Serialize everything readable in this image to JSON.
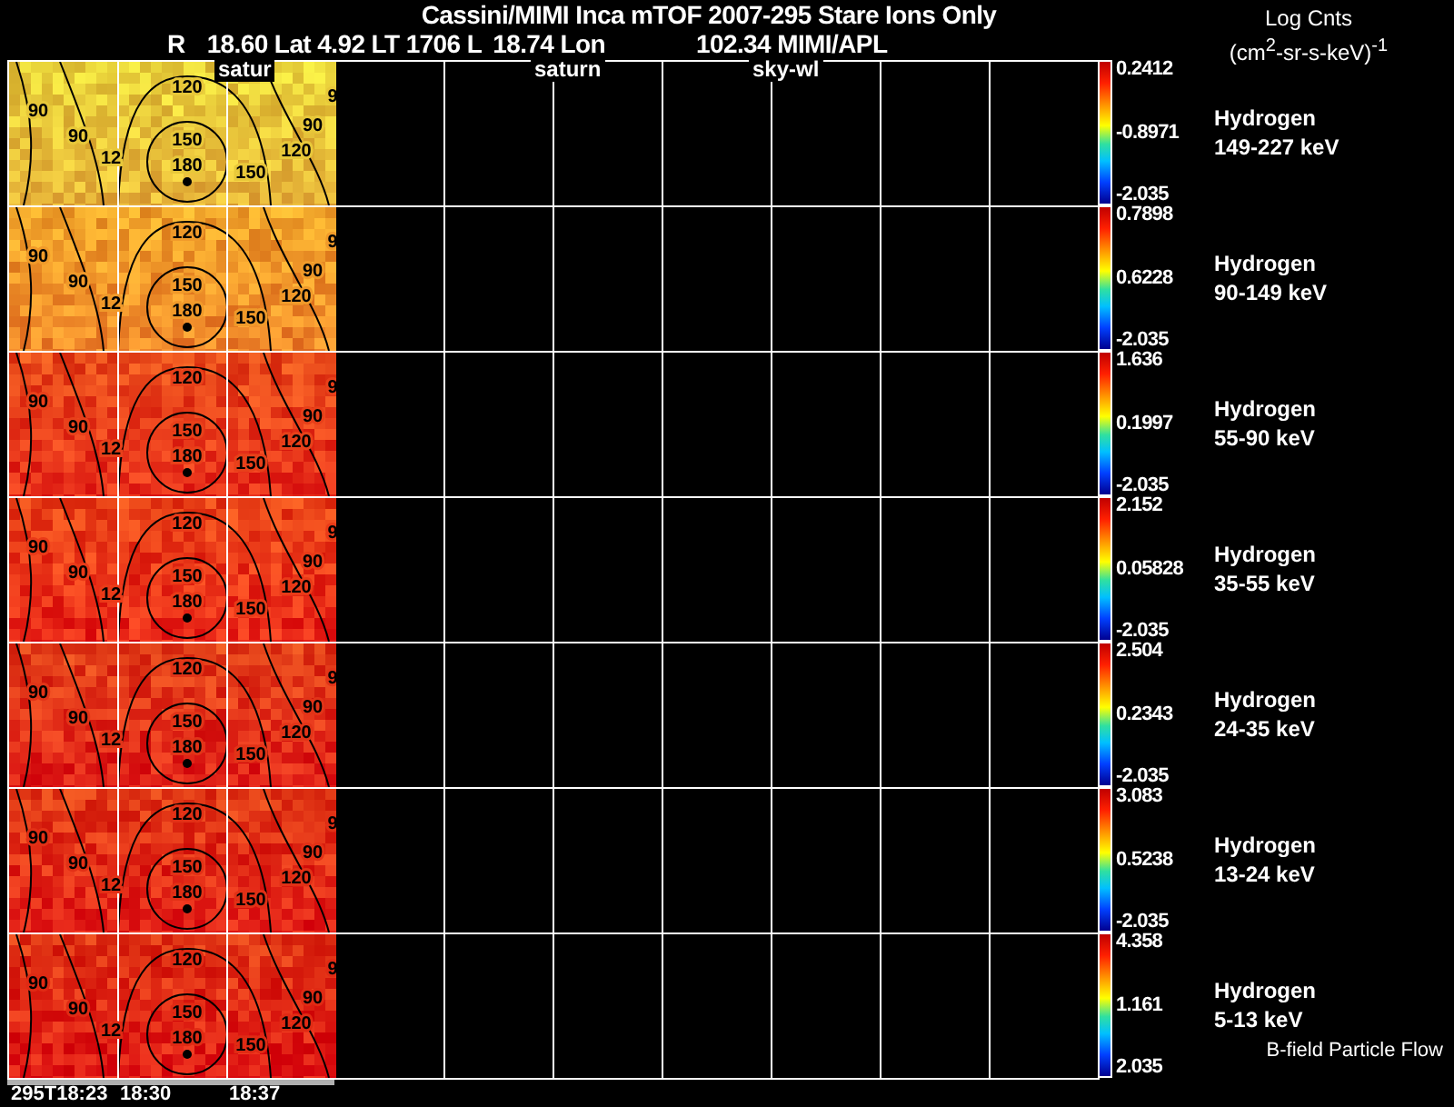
{
  "title": "Cassini/MIMI Inca mTOF  2007-295   Stare   Ions Only",
  "subtitle": [
    {
      "text": "R"
    },
    {
      "text": "18.60 Lat 4.92 LT 1706 L"
    },
    {
      "text": "18.74 Lon"
    },
    {
      "text": "102.34  MIMI/APL"
    }
  ],
  "units": {
    "line_1": "Log Cnts",
    "line_2": "(cm$^{2}$-sr-s-keV)$^{-1}$"
  },
  "overlay_labels": [
    {
      "text": "satur"
    },
    {
      "text": "saturn"
    },
    {
      "text": "sky-wl"
    }
  ],
  "panels": [
    {
      "species": "Hydrogen",
      "energy": "149-227 keV",
      "max": "0.2412",
      "mid": "-0.8971",
      "min": "-2.035",
      "color": "#e8c83a",
      "contour_labels": [
        "90",
        "90",
        "12",
        "120",
        "150",
        "180",
        "150",
        "120",
        "90",
        "9"
      ]
    },
    {
      "species": "Hydrogen",
      "energy": "90-149 keV",
      "max": "0.7898",
      "mid": "0.6228",
      "min": "-2.035",
      "color": "#f09a2a",
      "contour_labels": [
        "90",
        "90",
        "12",
        "120",
        "150",
        "180",
        "150",
        "120",
        "90",
        "9"
      ]
    },
    {
      "species": "Hydrogen",
      "energy": "55-90 keV",
      "max": "1.636",
      "mid": "0.1997",
      "min": "-2.035",
      "color": "#e8401a",
      "contour_labels": [
        "90",
        "90",
        "12",
        "120",
        "150",
        "180",
        "150",
        "120",
        "90",
        "9"
      ]
    },
    {
      "species": "Hydrogen",
      "energy": "35-55 keV",
      "max": "2.152",
      "mid": "0.05828",
      "min": "-2.035",
      "color": "#ea3a18",
      "contour_labels": [
        "90",
        "90",
        "12",
        "120",
        "150",
        "180",
        "150",
        "120",
        "90",
        "9"
      ]
    },
    {
      "species": "Hydrogen",
      "energy": "24-35 keV",
      "max": "2.504",
      "mid": "0.2343",
      "min": "-2.035",
      "color": "#e23418",
      "contour_labels": [
        "90",
        "90",
        "12",
        "120",
        "150",
        "180",
        "150",
        "120",
        "90",
        "9"
      ]
    },
    {
      "species": "Hydrogen",
      "energy": "13-24 keV",
      "max": "3.083",
      "mid": "0.5238",
      "min": "-2.035",
      "color": "#e23016",
      "contour_labels": [
        "90",
        "90",
        "12",
        "120",
        "150",
        "180",
        "150",
        "120",
        "90",
        "9"
      ]
    },
    {
      "species": "Hydrogen",
      "energy": "5-13 keV",
      "max": "4.358",
      "mid": "1.161",
      "min": "2.035",
      "color": "#e02a14",
      "contour_labels": [
        "90",
        "90",
        "12",
        "120",
        "150",
        "180",
        "150",
        "120",
        "90",
        "9"
      ]
    }
  ],
  "legend_note": "B-field Particle Flow",
  "time_labels": [
    "295T18:23",
    "18:30",
    "18:37"
  ]
}
